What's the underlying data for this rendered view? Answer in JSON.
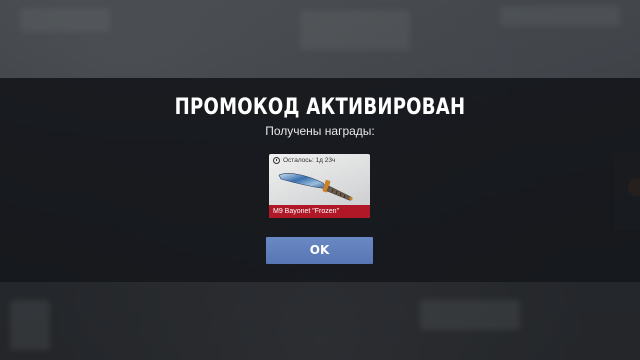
{
  "dialog": {
    "title": "ПРОМОКОД АКТИВИРОВАН",
    "subtitle": "Получены награды:",
    "ok_label": "OK"
  },
  "reward": {
    "timer_text": "Осталось: 1д 23ч",
    "item_name": "M9 Bayonet \"Frozen\"",
    "rarity_color": "#b01828"
  },
  "colors": {
    "accent_button": "#5f7fbc",
    "overlay": "#16181c"
  }
}
